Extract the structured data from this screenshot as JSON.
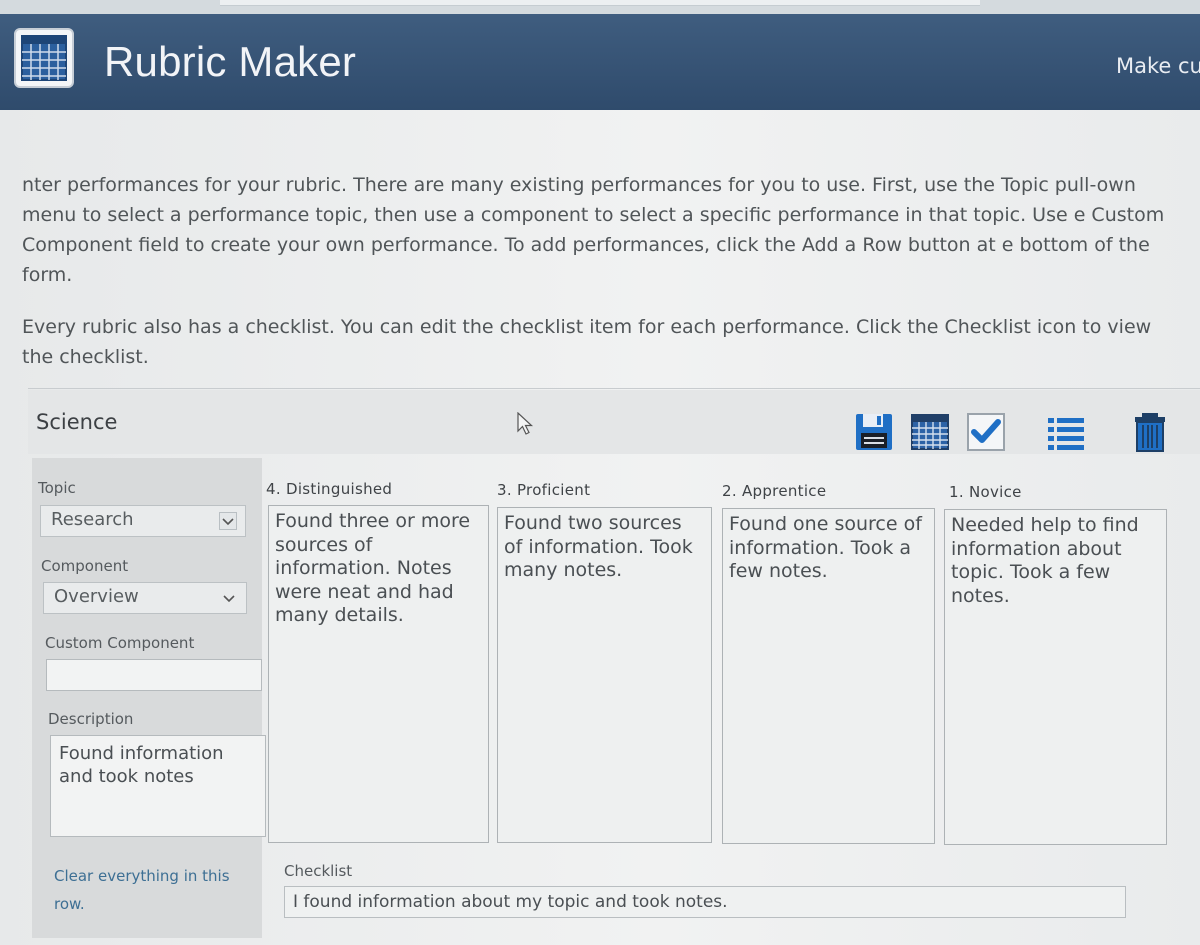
{
  "header": {
    "app_title": "Rubric Maker",
    "link_text": "Make cu"
  },
  "intro": {
    "paragraph1": "nter performances for your rubric. There are many existing performances for you to use. First, use the Topic pull-own menu to select a performance topic, then use a component to select a specific performance in that topic. Use e Custom Component field to create your own performance. To add performances, click the Add a Row button at e bottom of the form.",
    "paragraph2": "Every rubric also has a checklist. You can edit the checklist item for each performance. Click the Checklist icon to view the checklist."
  },
  "panel": {
    "subject": "Science",
    "toolbar": [
      "save-icon",
      "grid-icon",
      "checkmark-icon",
      "list-icon",
      "trash-icon"
    ]
  },
  "row": {
    "topic_label": "Topic",
    "topic_value": "Research",
    "component_label": "Component",
    "component_value": "Overview",
    "custom_label": "Custom Component",
    "custom_value": "",
    "description_label": "Description",
    "description_value": "Found information\nand took notes",
    "levels": [
      {
        "label": "4. Distinguished",
        "text": "Found three or more sources of information. Notes were neat and had many details."
      },
      {
        "label": "3. Proficient",
        "text": "Found two sources of information. Took many notes."
      },
      {
        "label": "2. Apprentice",
        "text": "Found one source of information. Took a few notes."
      },
      {
        "label": "1. Novice",
        "text": "Needed help to find information about topic. Took a few notes."
      }
    ],
    "clear_link": "Clear everything in this row.",
    "checklist_label": "Checklist",
    "checklist_value": "I found information about my topic and took notes."
  },
  "colors": {
    "header": "#34506f",
    "icon_blue": "#1f6fc5",
    "link": "#3d6f94"
  }
}
